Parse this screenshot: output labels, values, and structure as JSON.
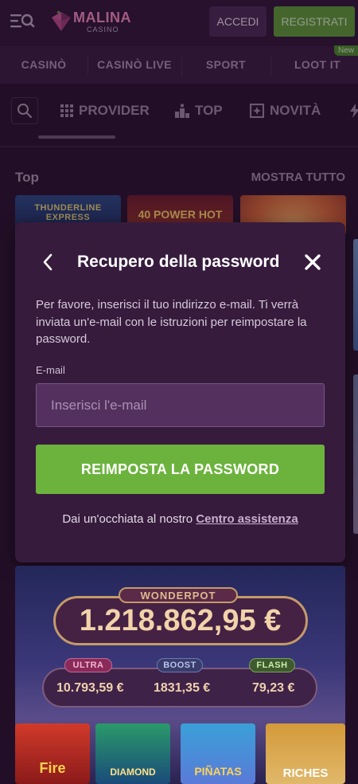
{
  "header": {
    "logo_name": "MALINA",
    "logo_sub": "CASINO",
    "login_label": "ACCEDI",
    "register_label": "REGISTRATI"
  },
  "nav": {
    "items": [
      "CASINÒ",
      "CASINÒ LIVE",
      "SPORT",
      "LOOT IT"
    ],
    "new_badge": "New"
  },
  "subtabs": {
    "items": [
      "PROVIDER",
      "TOP",
      "NOVITÀ"
    ]
  },
  "section": {
    "title": "Top",
    "show_all": "MOSTRA TUTTO"
  },
  "games": {
    "thumb1": "THUNDERLINE EXPRESS",
    "thumb2": "40 POWER HOT"
  },
  "modal": {
    "title": "Recupero della password",
    "description": "Per favore, inserisci il tuo indirizzo e-mail. Ti verrà inviata un'e-mail con le istruzioni per reimpostare la password.",
    "email_label": "E-mail",
    "email_placeholder": "Inserisci l'e-mail",
    "email_value": "",
    "reset_button": "REIMPOSTA LA PASSWORD",
    "help_text": "Dai un'occhiata al nostro",
    "help_link": "Centro assistenza"
  },
  "wonderpot": {
    "badge": "WONDERPOT",
    "amount": "1.218.862,95 €",
    "ultra_label": "ULTRA",
    "ultra_value": "10.793,59 €",
    "boost_label": "BOOST",
    "boost_value": "1831,35 €",
    "flash_label": "FLASH",
    "flash_value": "79,23 €",
    "games": [
      "Fire",
      "DIAMOND",
      "PIÑATAS",
      "RICHES"
    ]
  },
  "colors": {
    "background": "#2a1430",
    "modal": "#361b3d",
    "accent_green": "#6cb33d",
    "input_bg": "#54305f"
  },
  "icons": {
    "menu": "menu-search-icon",
    "back": "chevron-left-icon",
    "close": "close-icon",
    "search": "search-icon",
    "provider": "grid-icon",
    "top": "podium-icon",
    "new": "gift-box-icon"
  }
}
